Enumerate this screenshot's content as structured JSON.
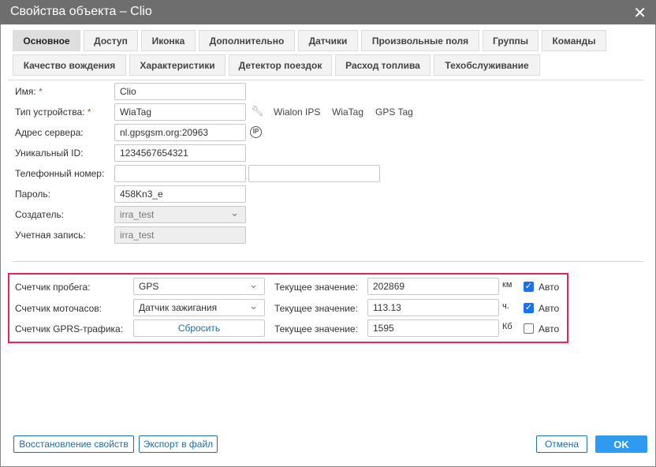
{
  "title": "Свойства объекта – Clio",
  "tabs_row1": [
    "Основное",
    "Доступ",
    "Иконка",
    "Дополнительно",
    "Датчики",
    "Произвольные поля",
    "Группы",
    "Команды"
  ],
  "tabs_row2": [
    "Качество вождения",
    "Характеристики",
    "Детектор поездок",
    "Расход топлива",
    "Техобслуживание"
  ],
  "form": {
    "name_label": "Имя:",
    "name": "Clio",
    "device_label": "Тип устройства:",
    "device": "WiaTag",
    "device_links": [
      "Wialon IPS",
      "WiaTag",
      "GPS Tag"
    ],
    "server_label": "Адрес сервера:",
    "server": "nl.gpsgsm.org:20963",
    "ip_icon": "IP",
    "uid_label": "Уникальный ID:",
    "uid": "1234567654321",
    "phone_label": "Телефонный номер:",
    "phone1": "",
    "phone2": "",
    "password_label": "Пароль:",
    "password": "458Kn3_e",
    "creator_label": "Создатель:",
    "creator": "irra_test",
    "account_label": "Учетная запись:",
    "account": "irra_test",
    "required_mark": "*"
  },
  "counters": {
    "current_label": "Текущее значение:",
    "auto_label": "Авто",
    "rows": [
      {
        "label": "Счетчик пробега:",
        "select": "GPS",
        "value": "202869",
        "unit": "км",
        "auto": true
      },
      {
        "label": "Счетчик моточасов:",
        "select": "Датчик зажигания",
        "value": "113.13",
        "unit": "ч.",
        "auto": true
      },
      {
        "label": "Счетчик GPRS-трафика:",
        "button": "Сбросить",
        "value": "1595",
        "unit": "Кб",
        "auto": false
      }
    ]
  },
  "footer": {
    "restore": "Восстановление свойств",
    "export": "Экспорт в файл",
    "cancel": "Отмена",
    "ok": "OK"
  },
  "colors": {
    "highlight": "#e8245a",
    "accent": "#2e9af0"
  }
}
